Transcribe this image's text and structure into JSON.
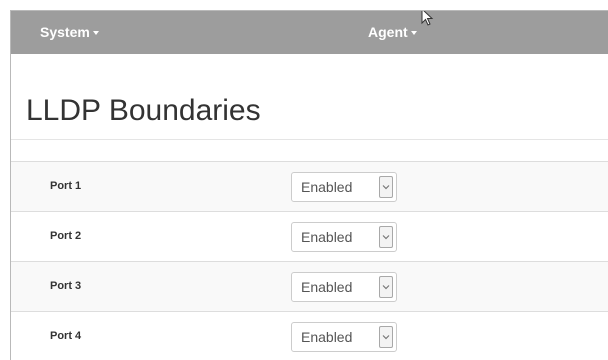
{
  "navbar": {
    "items": [
      {
        "label": "System"
      },
      {
        "label": "Agent"
      }
    ]
  },
  "page": {
    "title": "LLDP Boundaries"
  },
  "ports": [
    {
      "label": "Port 1",
      "value": "Enabled"
    },
    {
      "label": "Port 2",
      "value": "Enabled"
    },
    {
      "label": "Port 3",
      "value": "Enabled"
    },
    {
      "label": "Port 4",
      "value": "Enabled"
    }
  ],
  "colors": {
    "navbar_bg": "#9d9d9d",
    "navbar_text": "#ffffff",
    "row_stripe": "#f9f9f9",
    "title_text": "#333333"
  },
  "icons": {
    "nav_caret": "caret-down-icon",
    "select_arrow": "chevron-down-icon",
    "cursor": "mouse-pointer-icon"
  }
}
